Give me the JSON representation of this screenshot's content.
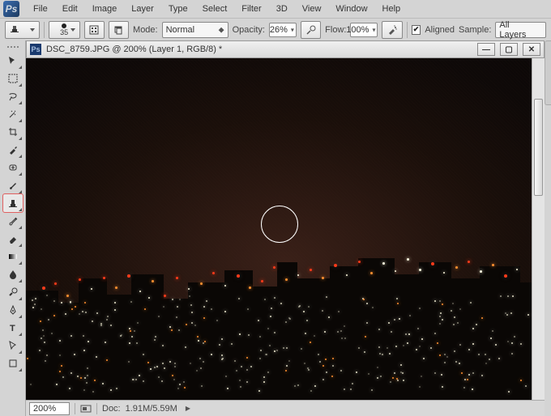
{
  "menu": [
    "File",
    "Edit",
    "Image",
    "Layer",
    "Type",
    "Select",
    "Filter",
    "3D",
    "View",
    "Window",
    "Help"
  ],
  "toolbar": {
    "brush_size": "35",
    "mode_label": "Mode:",
    "mode_value": "Normal",
    "opacity_label": "Opacity:",
    "opacity_value": "26%",
    "flow_label": "Flow:",
    "flow_value": "100%",
    "aligned_label": "Aligned",
    "sample_label": "Sample:",
    "sample_value": "All Layers"
  },
  "doc": {
    "title": "DSC_8759.JPG @ 200% (Layer 1, RGB/8) *"
  },
  "status": {
    "zoom": "200%",
    "doc_label": "Doc:",
    "doc_value": "1.91M/5.59M"
  },
  "tools": [
    "move",
    "marquee",
    "lasso",
    "wand",
    "crop",
    "eyedropper",
    "healing",
    "brush",
    "stamp",
    "history",
    "eraser",
    "gradient",
    "blur",
    "dodge",
    "pen",
    "type",
    "path",
    "shape"
  ]
}
